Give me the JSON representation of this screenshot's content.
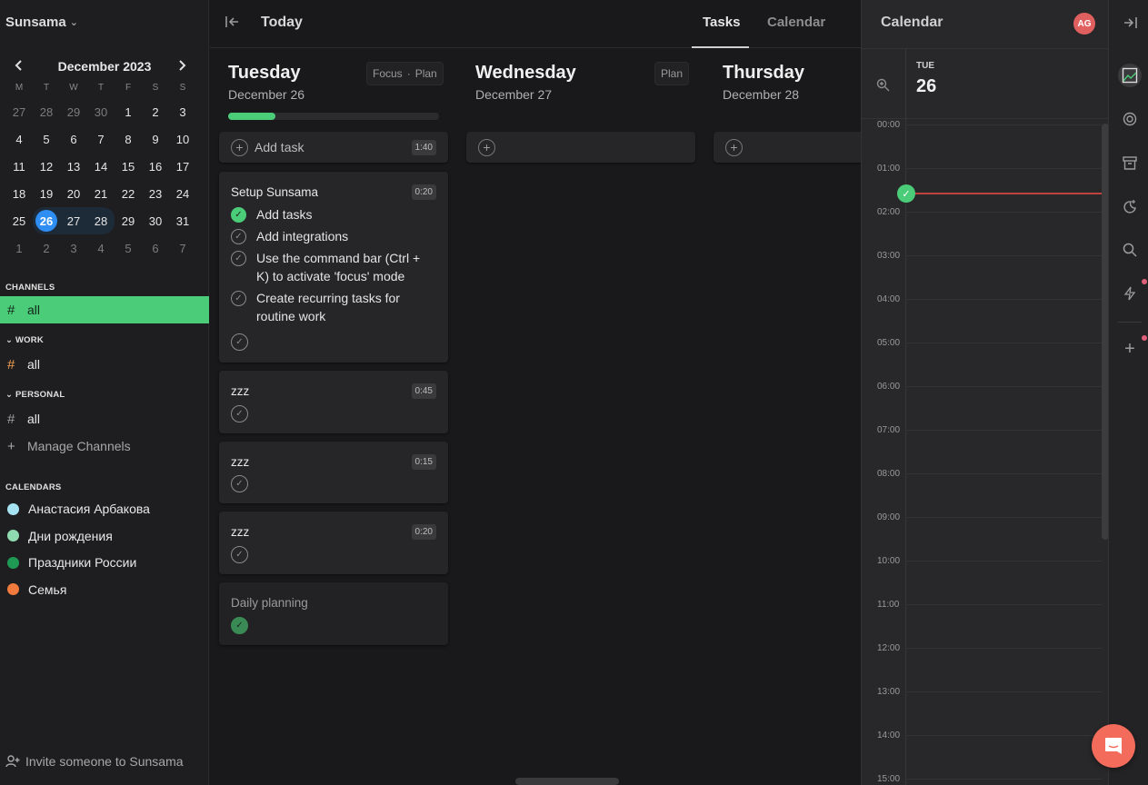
{
  "sidebar": {
    "brand": "Sunsama",
    "calendar": {
      "title": "December 2023",
      "weekdays": [
        "M",
        "T",
        "W",
        "T",
        "F",
        "S",
        "S"
      ],
      "weeks": [
        [
          "27",
          "28",
          "29",
          "30",
          "1",
          "2",
          "3"
        ],
        [
          "4",
          "5",
          "6",
          "7",
          "8",
          "9",
          "10"
        ],
        [
          "11",
          "12",
          "13",
          "14",
          "15",
          "16",
          "17"
        ],
        [
          "18",
          "19",
          "20",
          "21",
          "22",
          "23",
          "24"
        ],
        [
          "25",
          "26",
          "27",
          "28",
          "29",
          "30",
          "31"
        ],
        [
          "1",
          "2",
          "3",
          "4",
          "5",
          "6",
          "7"
        ]
      ],
      "selected_day": "26"
    },
    "channels_label": "CHANNELS",
    "channels_all": "all",
    "work_label": "WORK",
    "work_all": "all",
    "personal_label": "PERSONAL",
    "personal_all": "all",
    "manage_channels": "Manage Channels",
    "calendars_label": "CALENDARS",
    "calendars": [
      {
        "name": "Анастасия Арбакова",
        "color": "#a6e3f2"
      },
      {
        "name": "Дни рождения",
        "color": "#8fdcb0"
      },
      {
        "name": "Праздники России",
        "color": "#1f9a54"
      },
      {
        "name": "Семья",
        "color": "#f27a3c"
      }
    ],
    "invite": "Invite someone to Sunsama"
  },
  "topbar": {
    "title": "Today",
    "tab_tasks": "Tasks",
    "tab_calendar": "Calendar"
  },
  "columns": [
    {
      "day": "Tuesday",
      "date": "December 26",
      "focus": "Focus",
      "sep": "·",
      "plan": "Plan",
      "add_task": "Add task",
      "add_time": "1:40",
      "progress": 0.2
    },
    {
      "day": "Wednesday",
      "date": "December 27",
      "plan": "Plan"
    },
    {
      "day": "Thursday",
      "date": "December 28"
    }
  ],
  "cards": {
    "setup": {
      "title": "Setup Sunsama",
      "time": "0:20",
      "subtasks": [
        {
          "text": "Add tasks",
          "done": true
        },
        {
          "text": "Add integrations",
          "done": false
        },
        {
          "text": "Use the command bar (Ctrl + K) to activate 'focus' mode",
          "done": false
        },
        {
          "text": "Create recurring tasks for routine work",
          "done": false
        }
      ]
    },
    "zzz1": {
      "title": "zzz",
      "time": "0:45"
    },
    "zzz2": {
      "title": "zzz",
      "time": "0:15"
    },
    "zzz3": {
      "title": "zzz",
      "time": "0:20"
    },
    "daily": {
      "title": "Daily planning"
    }
  },
  "calpanel": {
    "title": "Calendar",
    "avatar": "AG",
    "day_abbr": "TUE",
    "day_num": "26",
    "hours": [
      "00:00",
      "01:00",
      "02:00",
      "03:00",
      "04:00",
      "05:00",
      "06:00",
      "07:00",
      "08:00",
      "09:00",
      "10:00",
      "11:00",
      "12:00",
      "13:00",
      "14:00",
      "15:00"
    ]
  },
  "colors": {
    "accent_green": "#4bcc78",
    "today_blue": "#2f8ef4",
    "now_line": "#c0423f",
    "chat": "#f26b5b"
  }
}
